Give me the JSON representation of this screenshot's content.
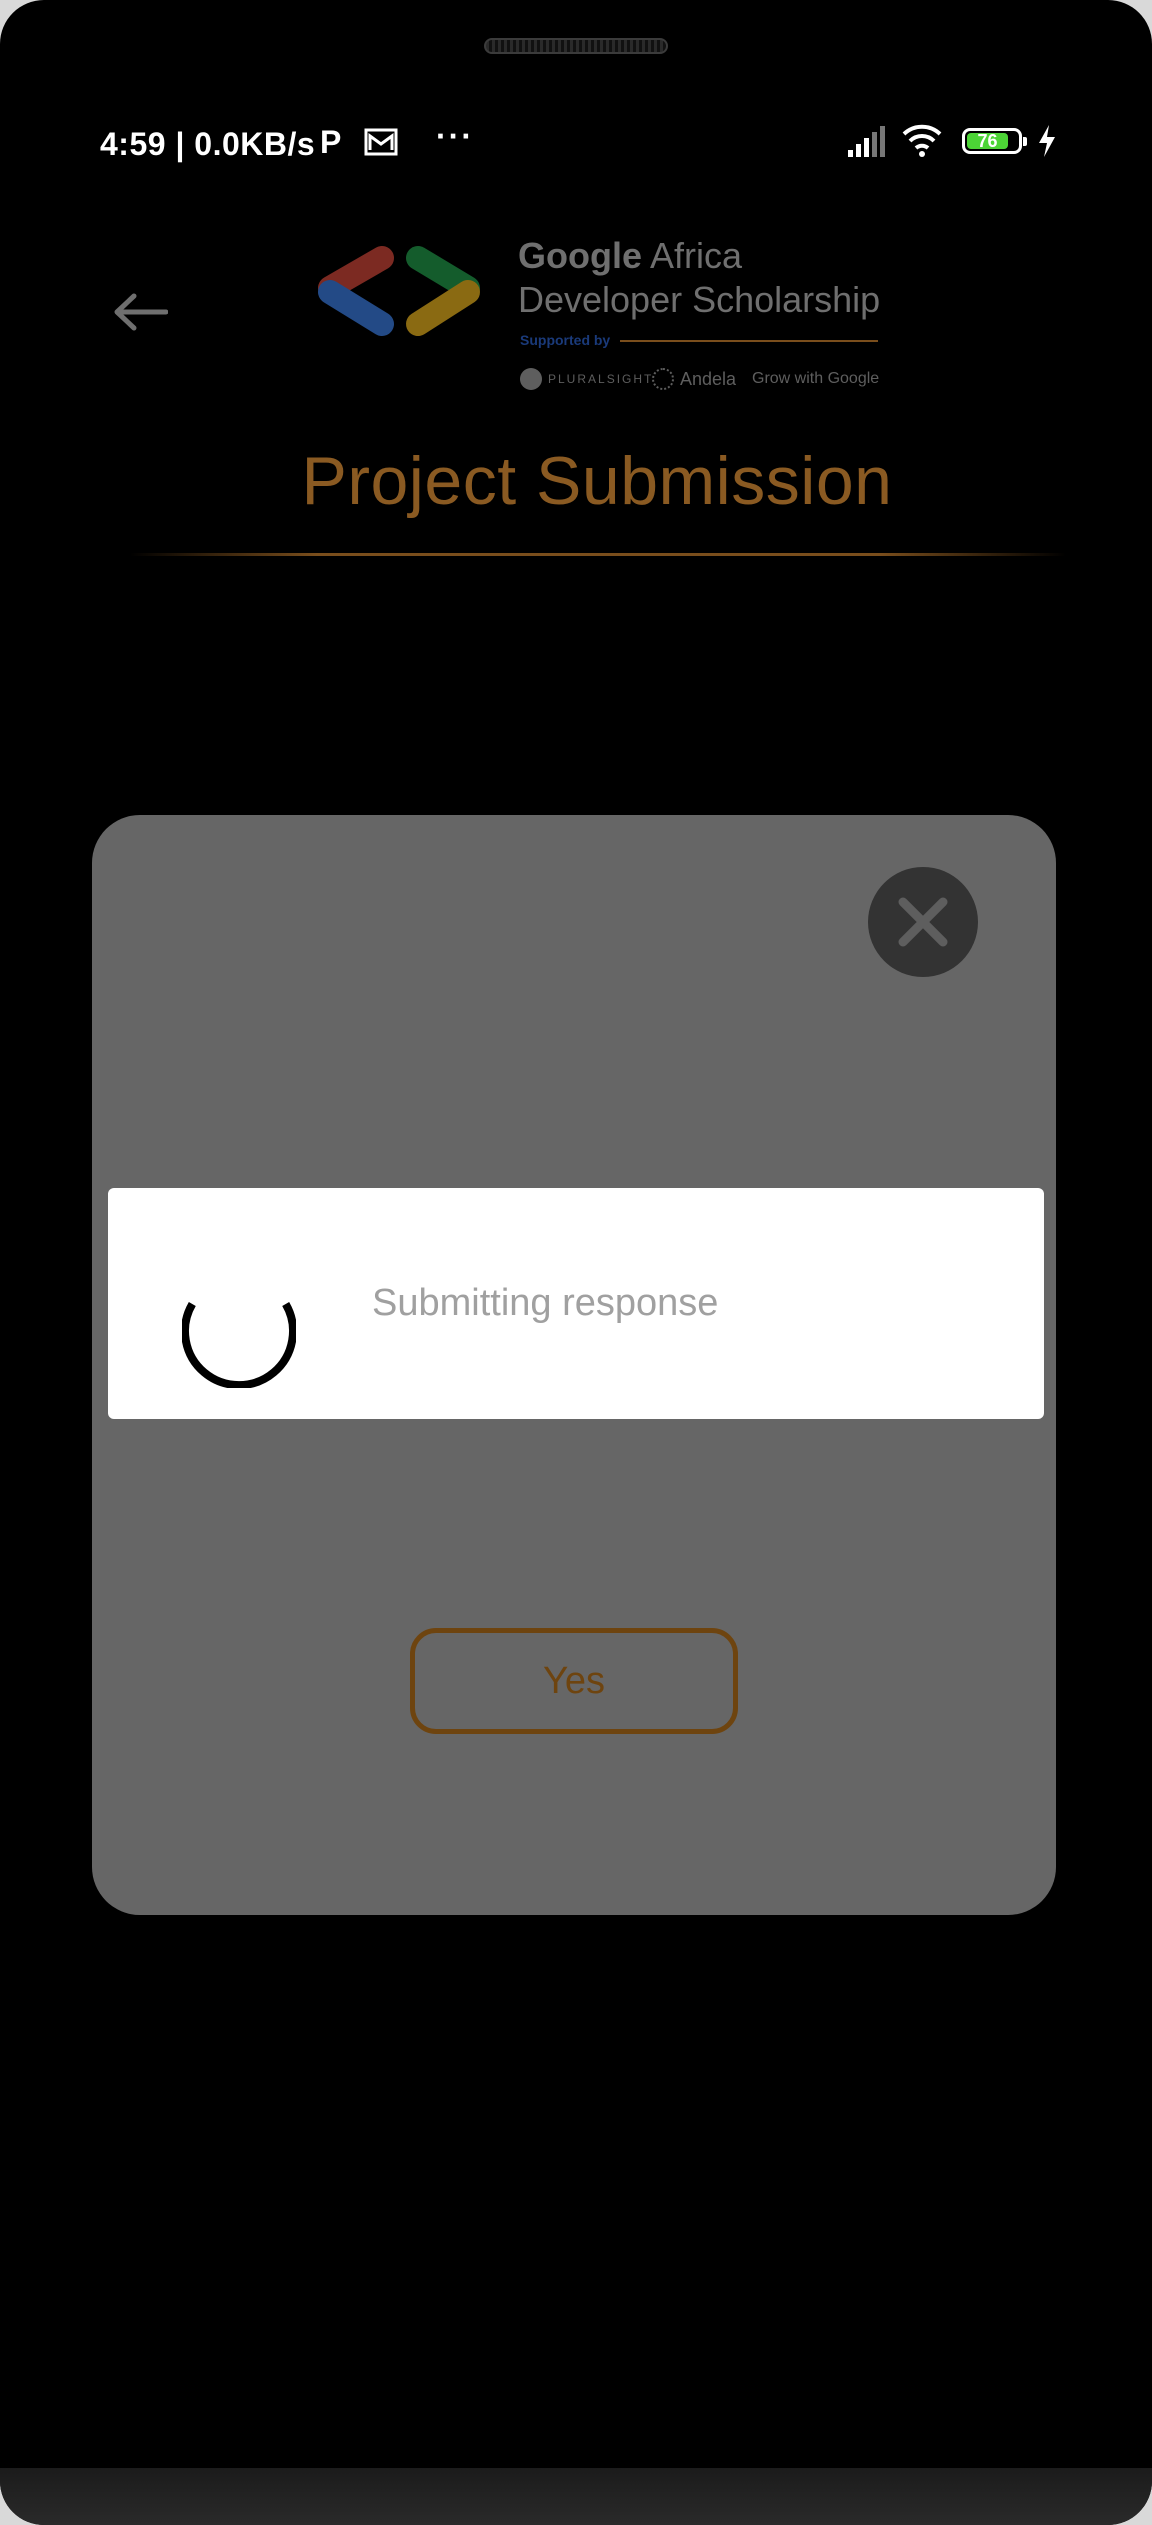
{
  "status_bar": {
    "time": "4:59 | 0.0KB/s",
    "p_icon": "P",
    "more": "···",
    "battery_level": "76",
    "battery_color": "#4cd436",
    "icons": [
      "mail-icon",
      "signal-icon",
      "wifi-icon",
      "battery-icon",
      "charging-bolt-icon"
    ]
  },
  "header": {
    "back_icon": "back-arrow-icon",
    "logo": {
      "brand_google": "Google",
      "brand_africa": " Africa",
      "brand_line2": "Developer Scholarship",
      "supported_by": "Supported by",
      "sponsors": [
        "PLURALSIGHT",
        "Andela",
        "Grow with Google"
      ]
    },
    "title": "Project Submission",
    "title_color": "#8a5a22"
  },
  "confirm_dialog": {
    "close_icon": "close-icon",
    "yes_label": "Yes",
    "accent": "#6e440f"
  },
  "progress_dialog": {
    "message": "Submitting response",
    "spinner_icon": "loading-spinner-icon"
  }
}
